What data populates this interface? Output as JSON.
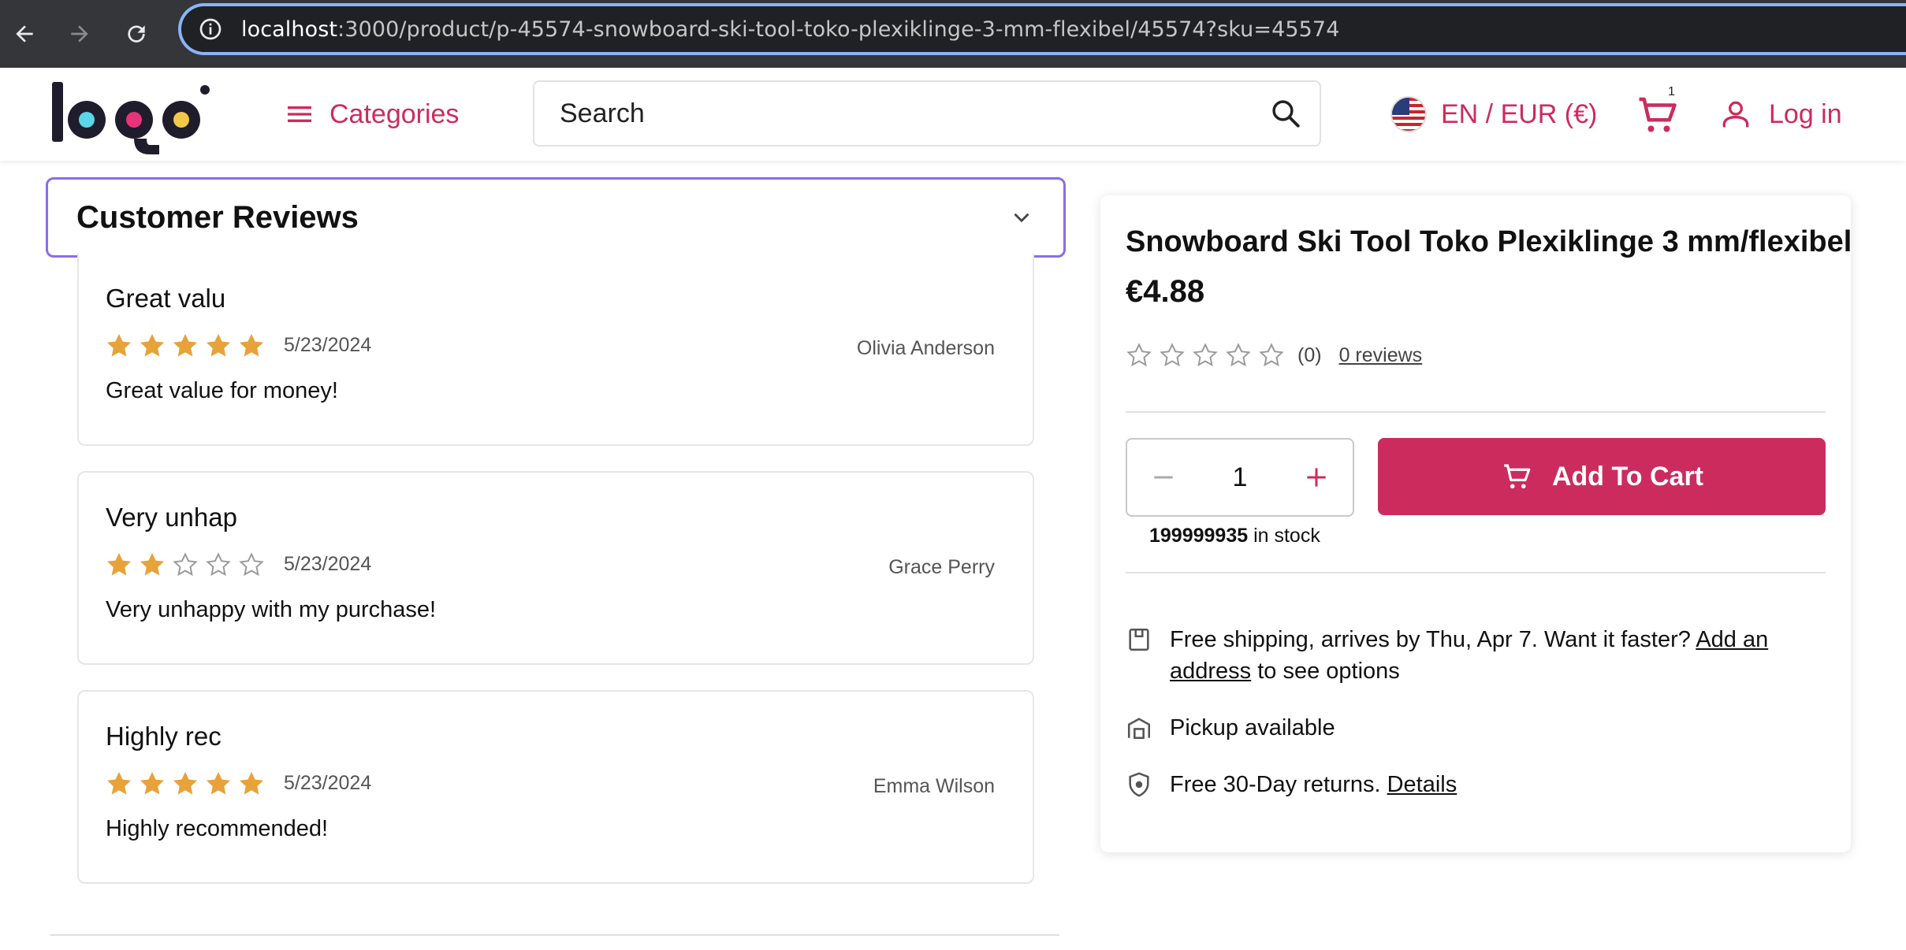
{
  "browser": {
    "url_host": "localhost",
    "url_path": ":3000/product/p-45574-snowboard-ski-tool-toko-plexiklinge-3-mm-flexibel/45574?sku=45574"
  },
  "header": {
    "categories_label": "Categories",
    "search_placeholder": "Search",
    "locale_label": "EN / EUR (€)",
    "cart_count": "1",
    "login_label": "Log in",
    "accent_color": "#cc2b5e"
  },
  "reviews": {
    "title": "Customer Reviews",
    "items": [
      {
        "title": "Great valu",
        "rating": 5,
        "date": "5/23/2024",
        "author": "Olivia Anderson",
        "body": "Great value for money!"
      },
      {
        "title": "Very unhap",
        "rating": 2,
        "date": "5/23/2024",
        "author": "Grace Perry",
        "body": "Very unhappy with my purchase!"
      },
      {
        "title": "Highly rec",
        "rating": 5,
        "date": "5/23/2024",
        "author": "Emma Wilson",
        "body": "Highly recommended!"
      }
    ]
  },
  "product": {
    "title": "Snowboard Ski Tool Toko Plexiklinge 3 mm/flexibel",
    "price": "€4.88",
    "rating": 0,
    "rating_count": "(0)",
    "reviews_link": "0 reviews",
    "quantity": "1",
    "stock_number": "199999935",
    "stock_suffix": " in stock",
    "add_to_cart_label": "Add To Cart",
    "shipping_text": "Free shipping, arrives by Thu, Apr 7. Want it faster? ",
    "shipping_link": "Add an address",
    "shipping_suffix": " to see options",
    "pickup_text": "Pickup available",
    "returns_text": "Free 30-Day returns. ",
    "returns_link": "Details"
  }
}
